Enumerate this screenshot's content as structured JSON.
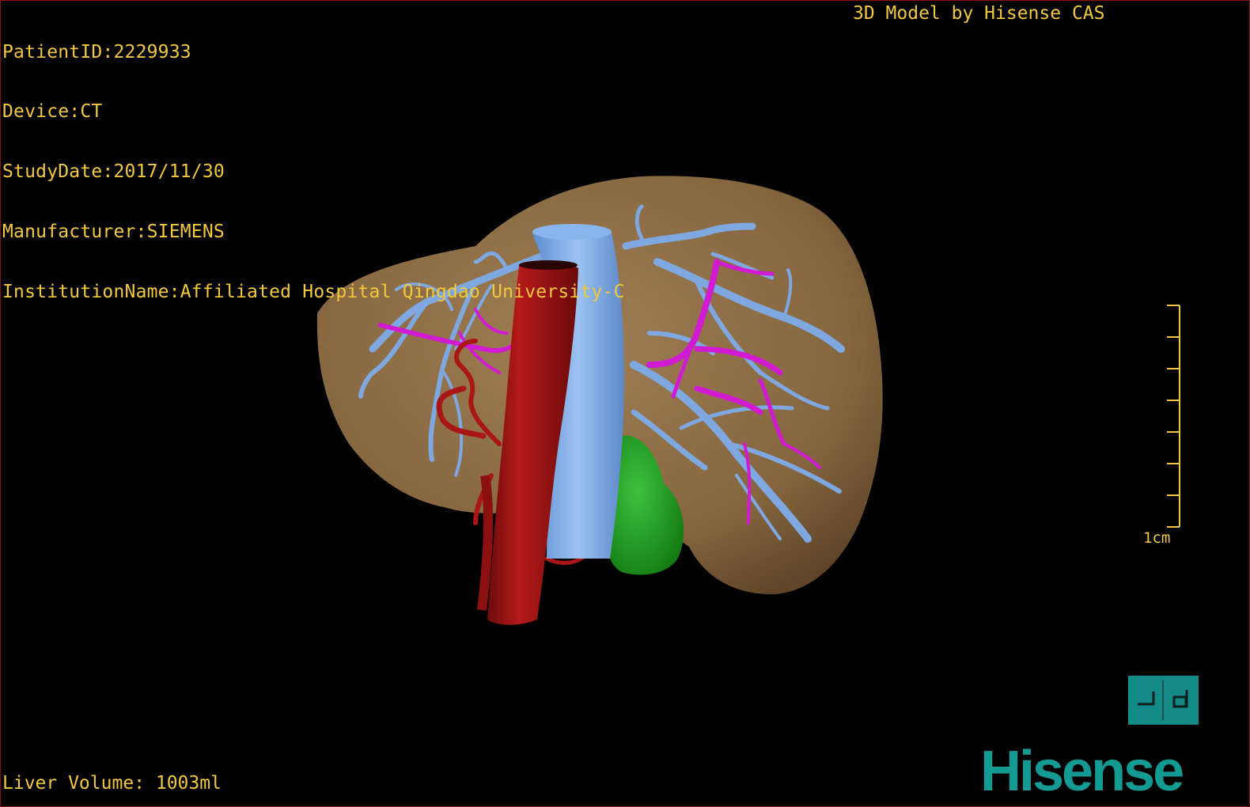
{
  "overlay": {
    "patient_id": "PatientID:2229933",
    "device": "Device:CT",
    "study_date": "StudyDate:2017/11/30",
    "manufacturer": "Manufacturer:SIEMENS",
    "institution": "InstitutionName:Affiliated Hospital Qingdao University-C",
    "model_credit": "3D Model by Hisense CAS",
    "liver_volume": "Liver Volume: 1003ml"
  },
  "scale_bar": {
    "label": "1cm"
  },
  "orientation_marker": {
    "icon": "orientation-cube-icon"
  },
  "brand": {
    "name": "Hisense"
  },
  "colors": {
    "overlay_text": "#f2c93a",
    "liver": "#8a6a45",
    "hepatic_vein": "#7fa8e0",
    "portal_vein": "#d21ad2",
    "aorta": "#9a1212",
    "tumor": "#1f9b1f",
    "brand": "#139a92"
  }
}
